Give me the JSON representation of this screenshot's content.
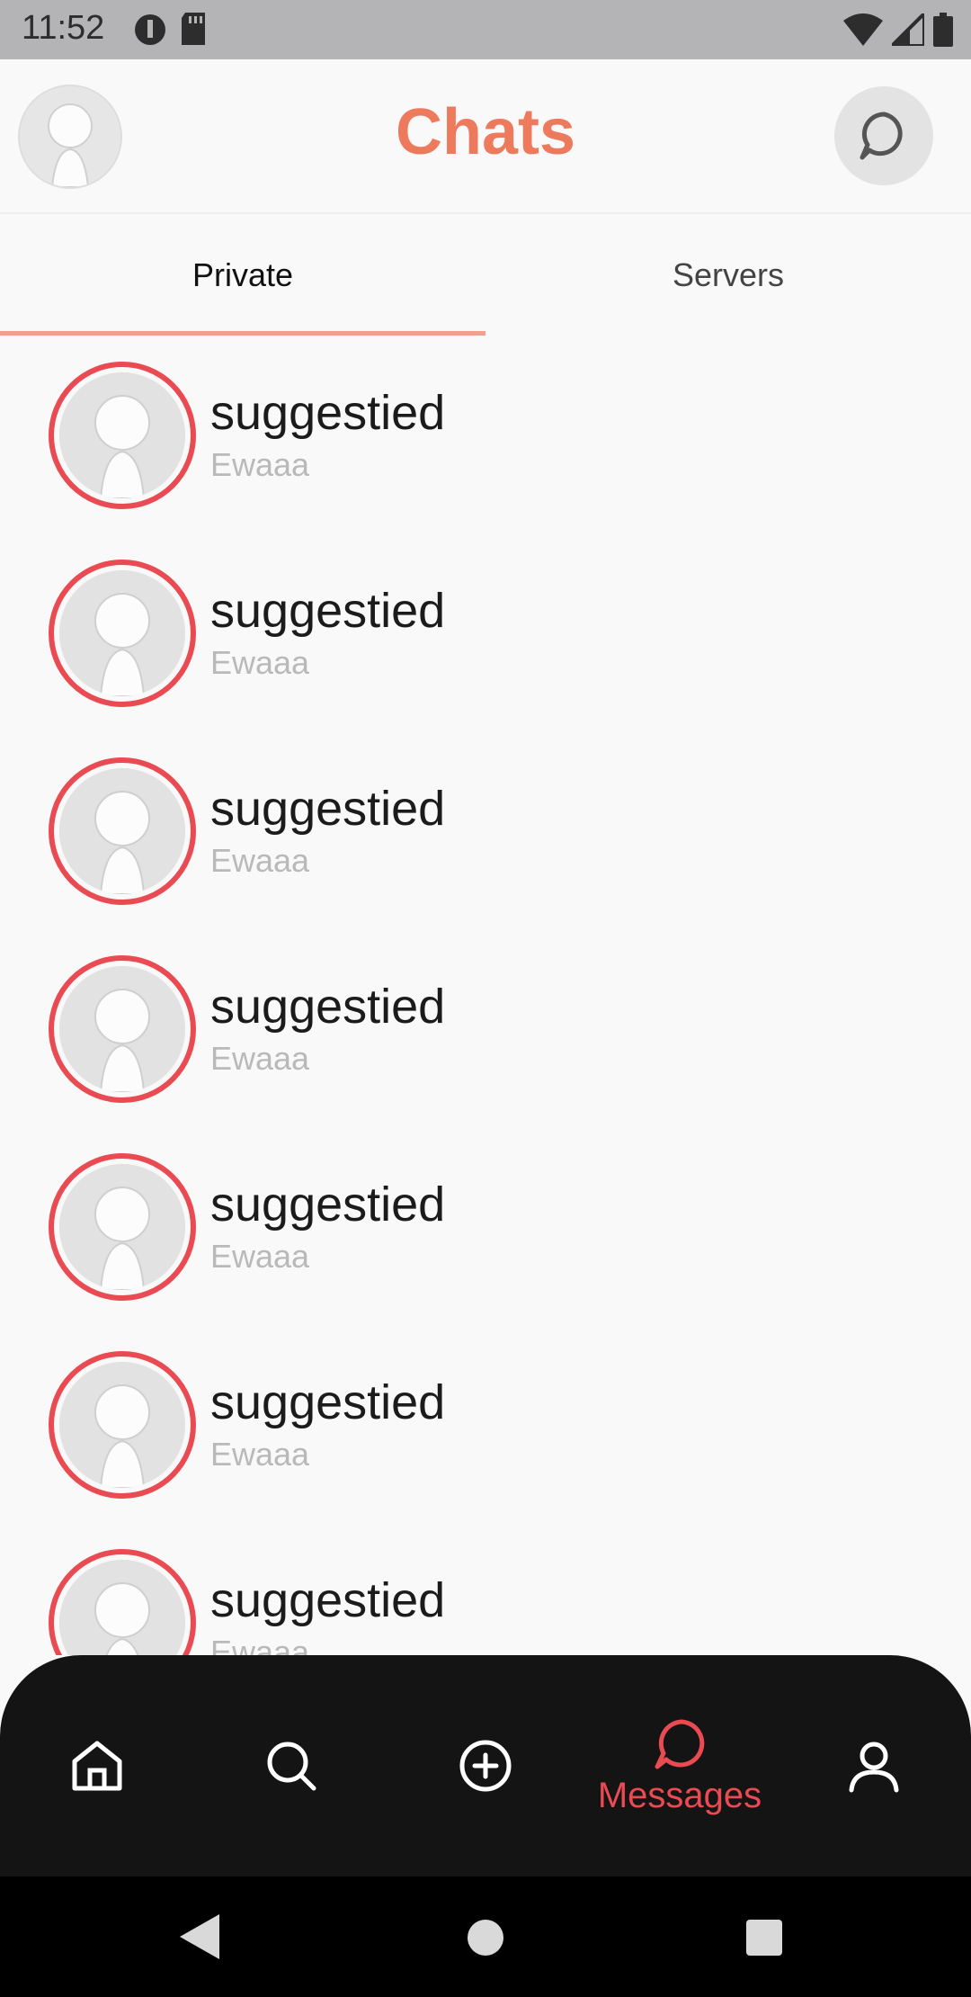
{
  "status_bar": {
    "time": "11:52"
  },
  "header": {
    "title": "Chats"
  },
  "tabs": [
    {
      "label": "Private",
      "active": true
    },
    {
      "label": "Servers",
      "active": false
    }
  ],
  "chats": [
    {
      "name": "suggestied",
      "subtitle": "Ewaaa"
    },
    {
      "name": "suggestied",
      "subtitle": "Ewaaa"
    },
    {
      "name": "suggestied",
      "subtitle": "Ewaaa"
    },
    {
      "name": "suggestied",
      "subtitle": "Ewaaa"
    },
    {
      "name": "suggestied",
      "subtitle": "Ewaaa"
    },
    {
      "name": "suggestied",
      "subtitle": "Ewaaa"
    },
    {
      "name": "suggestied",
      "subtitle": "Ewaaa"
    }
  ],
  "bottom_nav": {
    "items": [
      {
        "icon": "home-icon",
        "label": ""
      },
      {
        "icon": "search-icon",
        "label": ""
      },
      {
        "icon": "add-circle-icon",
        "label": ""
      },
      {
        "icon": "chat-bubble-icon",
        "label": "Messages",
        "active": true
      },
      {
        "icon": "user-icon",
        "label": ""
      }
    ]
  },
  "colors": {
    "accent": "#ee7a5e",
    "ring": "#ea4a51",
    "nav_bg": "#141414",
    "tab_underline": "#f2a08e"
  }
}
